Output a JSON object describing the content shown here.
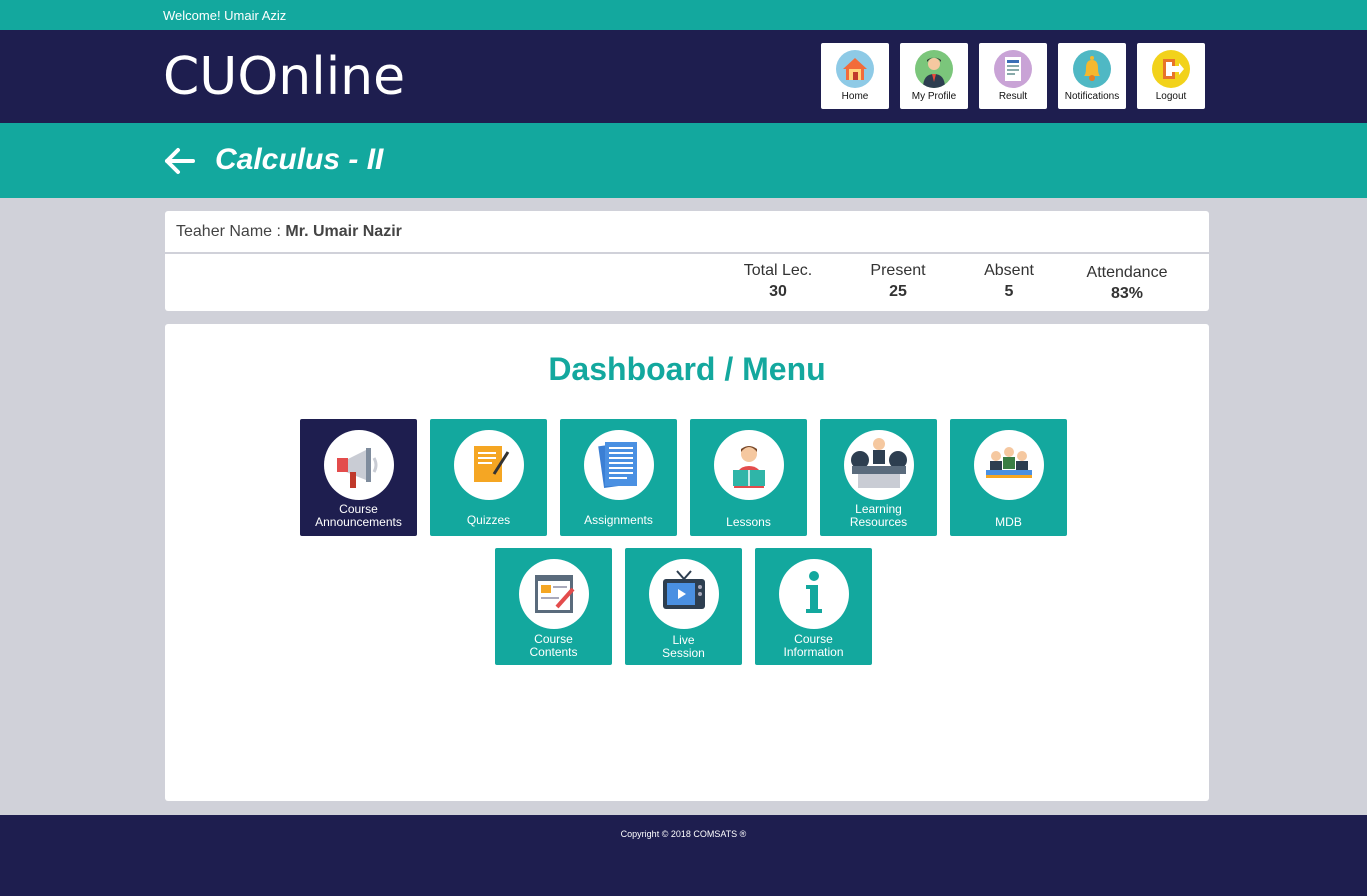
{
  "welcome": "Welcome! Umair Aziz",
  "brand": "CUOnline",
  "nav": [
    {
      "label": "Home",
      "icon": "home-icon"
    },
    {
      "label": "My Profile",
      "icon": "profile-icon"
    },
    {
      "label": "Result",
      "icon": "result-icon"
    },
    {
      "label": "Notifications",
      "icon": "bell-icon"
    },
    {
      "label": "Logout",
      "icon": "logout-icon"
    }
  ],
  "course_title": "Calculus - II",
  "teacher": {
    "label": "Teaher Name : ",
    "name": "Mr. Umair Nazir"
  },
  "stats": [
    {
      "label": "Total Lec.",
      "value": "30"
    },
    {
      "label": "Present",
      "value": "25"
    },
    {
      "label": "Absent",
      "value": "5"
    },
    {
      "label": "Attendance",
      "value": "83%"
    }
  ],
  "menu_title": "Dashboard / Menu",
  "tiles": [
    {
      "line1": "Course",
      "line2": "Announcements",
      "icon": "megaphone-icon"
    },
    {
      "line1": "Quizzes",
      "line2": "",
      "icon": "quiz-icon"
    },
    {
      "line1": "Assignments",
      "line2": "",
      "icon": "assignment-icon"
    },
    {
      "line1": "Lessons",
      "line2": "",
      "icon": "lesson-reader-icon"
    },
    {
      "line1": "Learning",
      "line2": "Resources",
      "icon": "learning-resources-icon"
    },
    {
      "line1": "MDB",
      "line2": "",
      "icon": "discussion-board-icon"
    },
    {
      "line1": "Course",
      "line2": "Contents",
      "icon": "course-contents-icon"
    },
    {
      "line1": "Live",
      "line2": "Session",
      "icon": "tv-icon"
    },
    {
      "line1": "Course",
      "line2": "Information",
      "icon": "info-icon"
    }
  ],
  "colors": {
    "teal": "#13a89e",
    "navy": "#1e1e4f",
    "background": "#d0d1d9"
  },
  "copyright": "Copyright © 2018 COMSATS ®"
}
